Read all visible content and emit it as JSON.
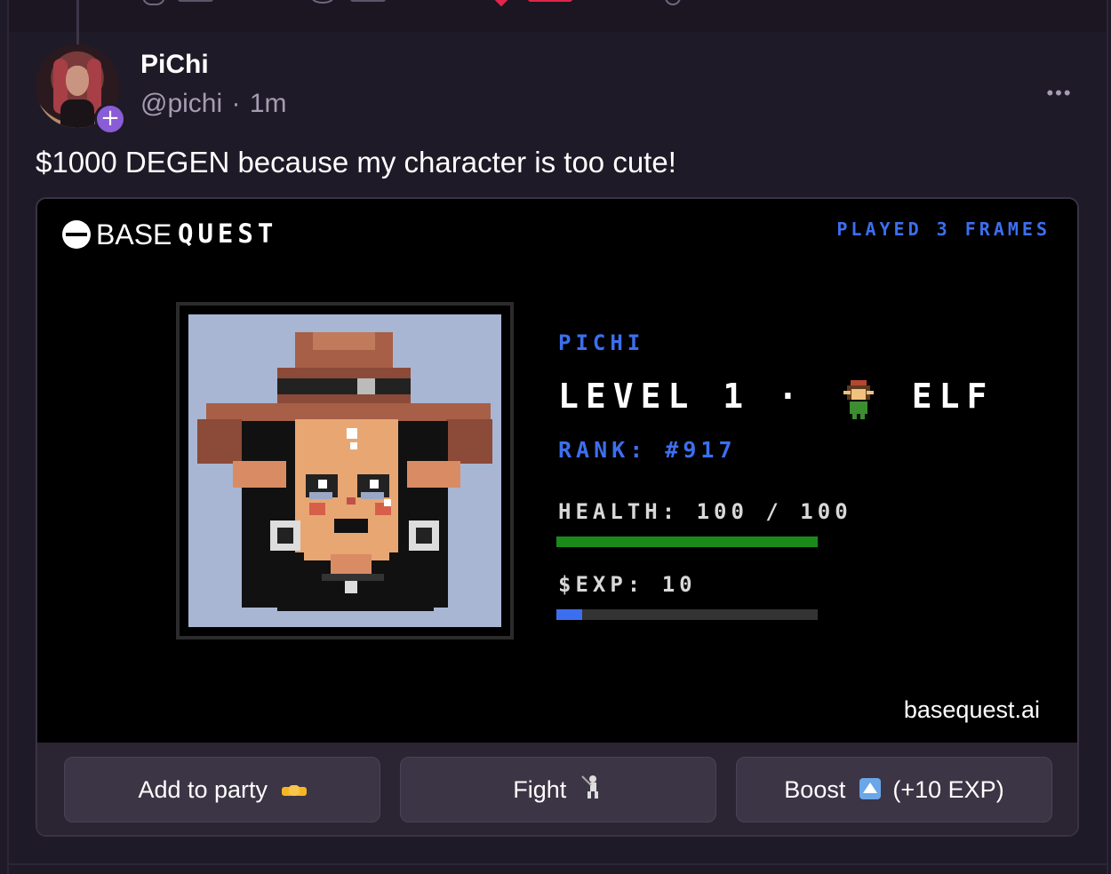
{
  "post": {
    "author_name": "PiChi",
    "handle": "@pichi",
    "separator": "·",
    "time": "1m",
    "text": "$1000 DEGEN because my character is too cute!"
  },
  "frame": {
    "logo_base": "BASE",
    "logo_quest": "QUEST",
    "played": "PLAYED 3 FRAMES",
    "character_name": "PICHI",
    "level_label": "LEVEL 1",
    "level_separator": "·",
    "class_emoji_icon": "elf-icon",
    "class_name": "ELF",
    "rank": "RANK: #917",
    "health": "HEALTH: 100 / 100",
    "health_fraction": 1.0,
    "exp": "$EXP: 10",
    "exp_fraction": 0.1,
    "site": "basequest.ai",
    "colors": {
      "accent_blue": "#3c6ff0",
      "health_green": "#1a8a1a",
      "portrait_bg": "#a9b6d3"
    }
  },
  "buttons": [
    {
      "label": "Add to party",
      "icon": "handshake-icon"
    },
    {
      "label": "Fight",
      "icon": "fencer-icon"
    },
    {
      "label": "Boost",
      "icon": "up-arrow-button-icon",
      "suffix": "(+10 EXP)"
    }
  ],
  "more_label": "•••"
}
